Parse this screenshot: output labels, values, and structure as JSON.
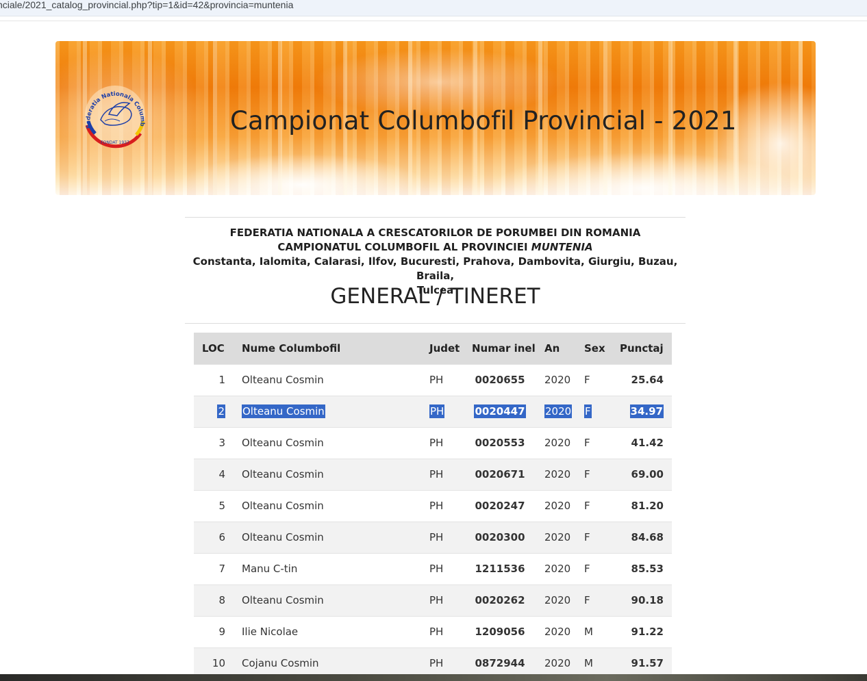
{
  "browser": {
    "url": "nciale/2021_catalog_provincial.php?tip=1&id=42&provincia=muntenia"
  },
  "banner": {
    "title": "Campionat Columbofil Provincial - 2021",
    "logo_text_top": "Federatia Nationala Columbofila din Romania",
    "logo_text_bottom": "FONDAT 1937"
  },
  "header": {
    "line1": "FEDERATIA NATIONALA A CRESCATORILOR DE PORUMBEI DIN ROMANIA",
    "line2_prefix": "CAMPIONATUL COLUMBOFIL AL PROVINCIEI ",
    "line2_province": "MUNTENIA",
    "line3": "Constanta, Ialomita, Calarasi, Ilfov, Bucuresti, Prahova, Dambovita, Giurgiu, Buzau, Braila,",
    "line4": "Tulcea",
    "category": "GENERAL / TINERET"
  },
  "table": {
    "columns": [
      "LOC",
      "Nume Columbofil",
      "Judet",
      "Numar inel",
      "An",
      "Sex",
      "Punctaj"
    ],
    "rows": [
      {
        "loc": "1",
        "nume": "Olteanu Cosmin",
        "judet": "PH",
        "inel": "0020655",
        "an": "2020",
        "sex": "F",
        "punctaj": "25.64"
      },
      {
        "loc": "2",
        "nume": "Olteanu Cosmin",
        "judet": "PH",
        "inel": "0020447",
        "an": "2020",
        "sex": "F",
        "punctaj": "34.97"
      },
      {
        "loc": "3",
        "nume": "Olteanu Cosmin",
        "judet": "PH",
        "inel": "0020553",
        "an": "2020",
        "sex": "F",
        "punctaj": "41.42"
      },
      {
        "loc": "4",
        "nume": "Olteanu Cosmin",
        "judet": "PH",
        "inel": "0020671",
        "an": "2020",
        "sex": "F",
        "punctaj": "69.00"
      },
      {
        "loc": "5",
        "nume": "Olteanu Cosmin",
        "judet": "PH",
        "inel": "0020247",
        "an": "2020",
        "sex": "F",
        "punctaj": "81.20"
      },
      {
        "loc": "6",
        "nume": "Olteanu Cosmin",
        "judet": "PH",
        "inel": "0020300",
        "an": "2020",
        "sex": "F",
        "punctaj": "84.68"
      },
      {
        "loc": "7",
        "nume": "Manu C-tin",
        "judet": "PH",
        "inel": "1211536",
        "an": "2020",
        "sex": "F",
        "punctaj": "85.53"
      },
      {
        "loc": "8",
        "nume": "Olteanu Cosmin",
        "judet": "PH",
        "inel": "0020262",
        "an": "2020",
        "sex": "F",
        "punctaj": "90.18"
      },
      {
        "loc": "9",
        "nume": "Ilie Nicolae",
        "judet": "PH",
        "inel": "1209056",
        "an": "2020",
        "sex": "M",
        "punctaj": "91.22"
      },
      {
        "loc": "10",
        "nume": "Cojanu Cosmin",
        "judet": "PH",
        "inel": "0872944",
        "an": "2020",
        "sex": "M",
        "punctaj": "91.57"
      }
    ],
    "selected_row": "2"
  },
  "colors": {
    "banner_orange": "#f07c0a",
    "header_row_bg": "#dcdcdc",
    "stripe_bg": "#f2f2f2",
    "selection": "#3467c7"
  }
}
